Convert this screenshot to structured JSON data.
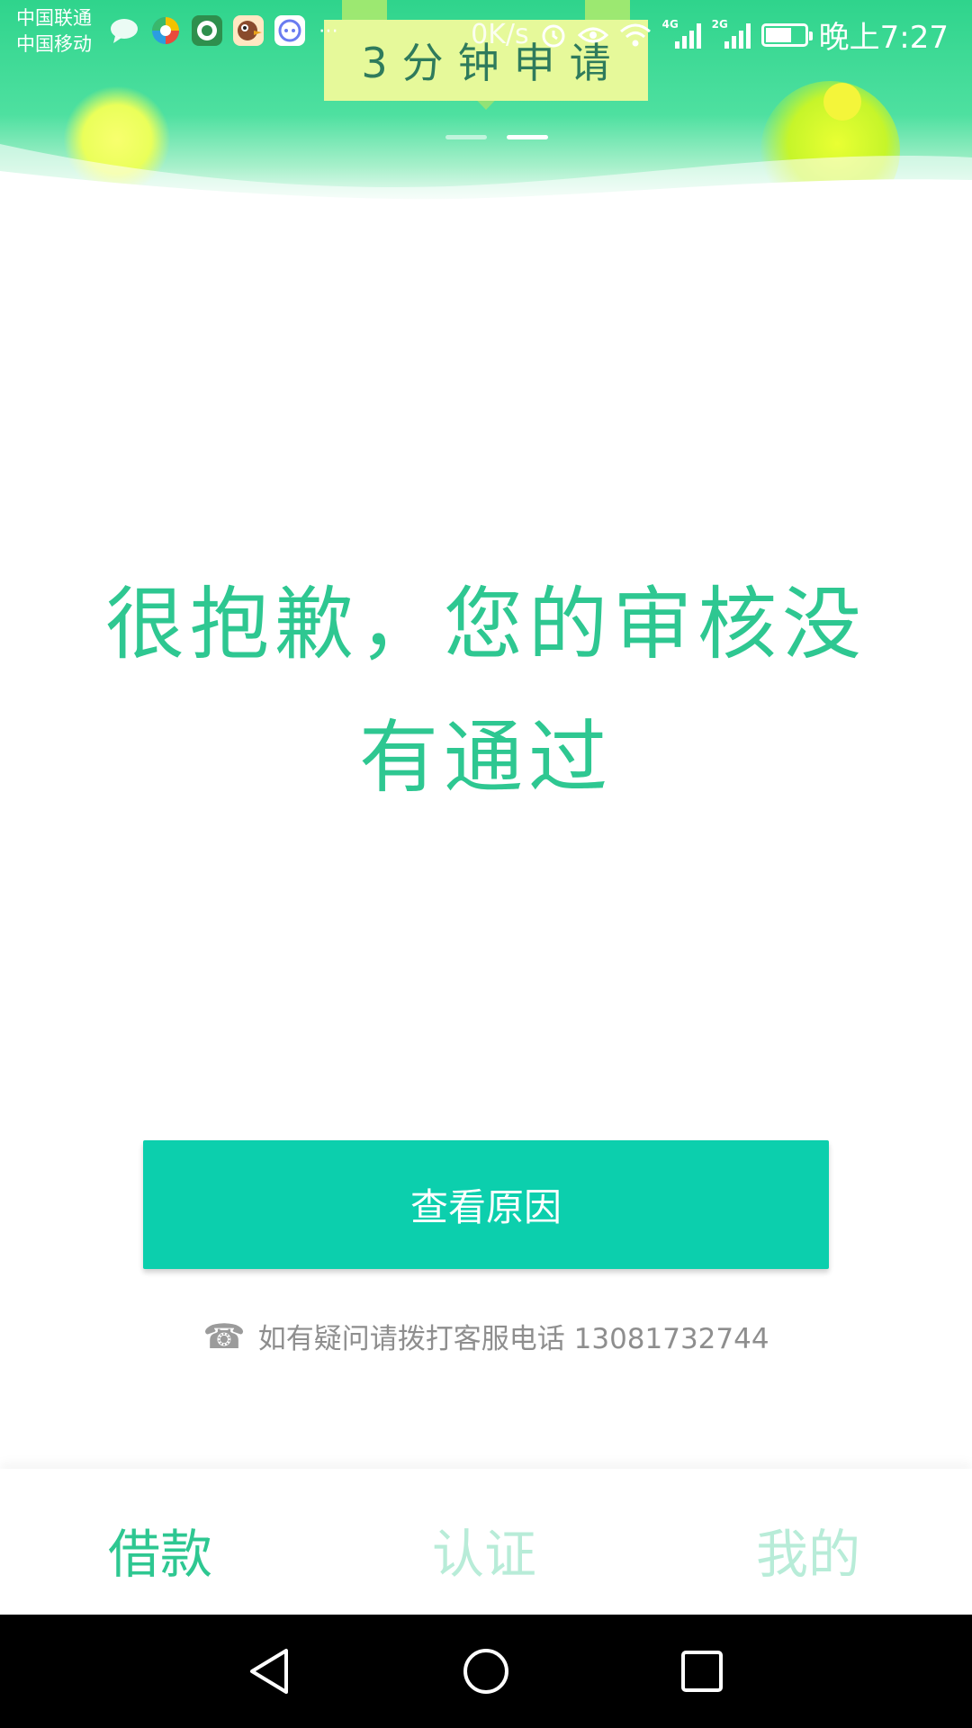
{
  "status_bar": {
    "carrier_1": "中国联通",
    "carrier_2": "中国移动",
    "net_speed": "0K/s",
    "signal_1_tag": "4G",
    "signal_2_tag": "2G",
    "time": "晚上7:27"
  },
  "banner": {
    "headline": "3分钟申请",
    "page_count": 2,
    "active_page": 2
  },
  "main": {
    "message_line_1": "很抱歉，您的审核没",
    "message_line_2": "有通过",
    "action_button": "查看原因",
    "hotline_text": "如有疑问请拨打客服电话 13081732744"
  },
  "tabs": [
    {
      "label": "借款",
      "active": true
    },
    {
      "label": "认证",
      "active": false
    },
    {
      "label": "我的",
      "active": false
    }
  ],
  "colors": {
    "accent": "#2ec791",
    "button": "#0ccfad",
    "tab_inactive": "#b8ecd8",
    "hint_text": "#8e8e8e"
  },
  "icons": {
    "notifications": [
      "message-icon",
      "colorful-app-icon",
      "camera-app-icon",
      "bird-app-icon",
      "chat-app-icon",
      "more-icon"
    ],
    "status": [
      "alarm-icon",
      "eye-icon",
      "wifi-icon",
      "signal-icon",
      "battery-icon"
    ],
    "hotline": "phone-icon",
    "nav": [
      "back-icon",
      "home-icon",
      "recent-apps-icon"
    ]
  }
}
